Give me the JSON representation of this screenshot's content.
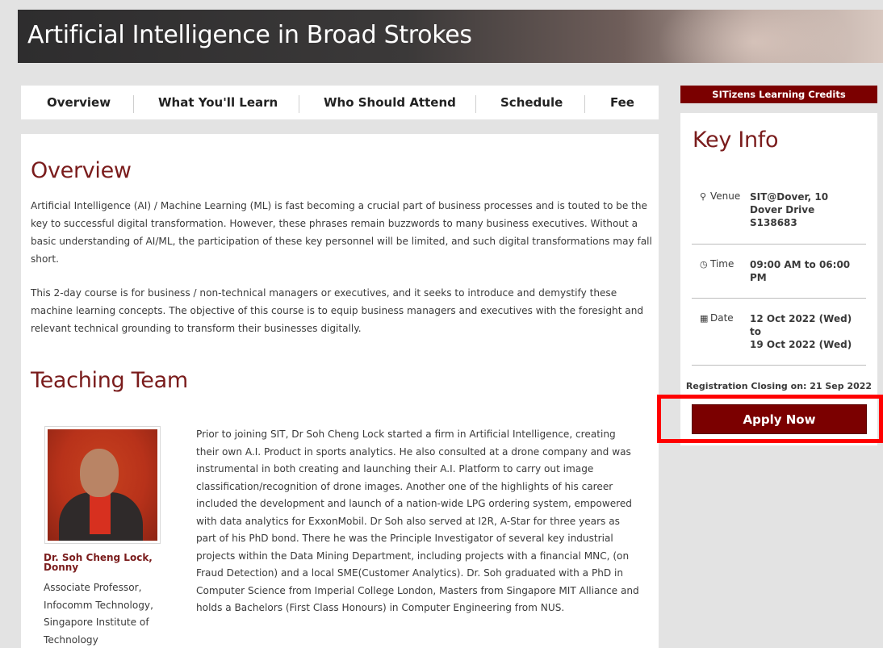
{
  "banner": {
    "title": "Artificial Intelligence in Broad Strokes"
  },
  "tabs": [
    {
      "label": "Overview"
    },
    {
      "label": "What You'll Learn"
    },
    {
      "label": "Who Should Attend"
    },
    {
      "label": "Schedule"
    },
    {
      "label": "Fee"
    }
  ],
  "overview": {
    "heading": "Overview",
    "paragraphs": [
      "Artificial Intelligence (AI) / Machine Learning (ML) is fast becoming a crucial part of business processes and is touted to be the key to successful digital transformation. However, these phrases remain buzzwords to many business executives. Without a basic understanding of AI/ML, the participation of these key personnel will be limited, and such digital transformations may fall short.",
      "This 2-day course is for business / non-technical managers or executives, and it seeks to introduce and demystify these machine learning concepts. The objective of this course is to equip business managers and executives with the foresight and relevant technical grounding to transform their businesses digitally."
    ]
  },
  "team": {
    "heading": "Teaching Team",
    "members": [
      {
        "name": "Dr. Soh Cheng Lock, Donny",
        "role": "Associate Professor, Infocomm Technology, Singapore Institute of Technology",
        "bio": "Prior to joining SIT, Dr Soh Cheng Lock started a firm in Artificial Intelligence, creating their own A.I. Product in sports analytics. He also consulted at a drone company and was instrumental in both creating and launching their A.I. Platform to carry out image classification/recognition of drone images. Another one of the highlights of his career included the development and launch of a nation-wide LPG ordering system, empowered with data analytics for ExxonMobil. Dr Soh also served at I2R, A-Star for three years as part of his PhD bond. There he was the Principle Investigator of several key industrial projects within the Data Mining Department, including projects with a financial MNC, (on Fraud Detection) and a local SME(Customer Analytics). Dr. Soh graduated with a PhD in Computer Science from Imperial College London, Masters from Singapore MIT Alliance and holds a Bachelors (First Class Honours) in Computer Engineering from NUS."
      }
    ]
  },
  "sidebar": {
    "credits_label": "SITizens Learning Credits",
    "keyinfo_title": "Key Info",
    "venue": {
      "icon": "map-marker-icon",
      "label": "Venue",
      "value": "SIT@Dover, 10 Dover Drive S138683"
    },
    "time": {
      "icon": "clock-icon",
      "label": "Time",
      "value": "09:00 AM to 06:00 PM"
    },
    "date": {
      "icon": "calendar-icon",
      "label": "Date",
      "from": "12 Oct 2022 (Wed)",
      "to_word": "to",
      "to": "19 Oct 2022 (Wed)"
    },
    "closing": "Registration Closing on: 21 Sep 2022",
    "apply_label": "Apply Now"
  },
  "colors": {
    "accent": "#7b0000",
    "heading": "#7a1c1c",
    "highlight": "#ff0000",
    "background": "#e3e3e3"
  }
}
